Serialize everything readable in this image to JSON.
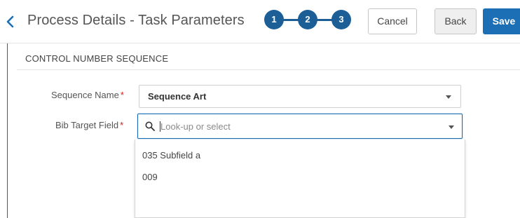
{
  "header": {
    "title": "Process Details - Task Parameters",
    "steps": [
      "1",
      "2",
      "3"
    ],
    "buttons": {
      "cancel": "Cancel",
      "back": "Back",
      "save": "Save"
    },
    "colors": {
      "step": "#1c5f97",
      "save": "#1c6fb5"
    }
  },
  "section": {
    "title": "CONTROL NUMBER SEQUENCE"
  },
  "form": {
    "sequence_name": {
      "label": "Sequence Name",
      "required_mark": "*",
      "value": "Sequence Art"
    },
    "bib_target_field": {
      "label": "Bib Target Field",
      "required_mark": "*",
      "placeholder": "Look-up or select",
      "value": "",
      "options": [
        "035 Subfield a",
        "009"
      ]
    }
  },
  "icons": {
    "back": "chevron-left-icon",
    "search": "search-icon",
    "dropdown": "caret-down-icon"
  }
}
